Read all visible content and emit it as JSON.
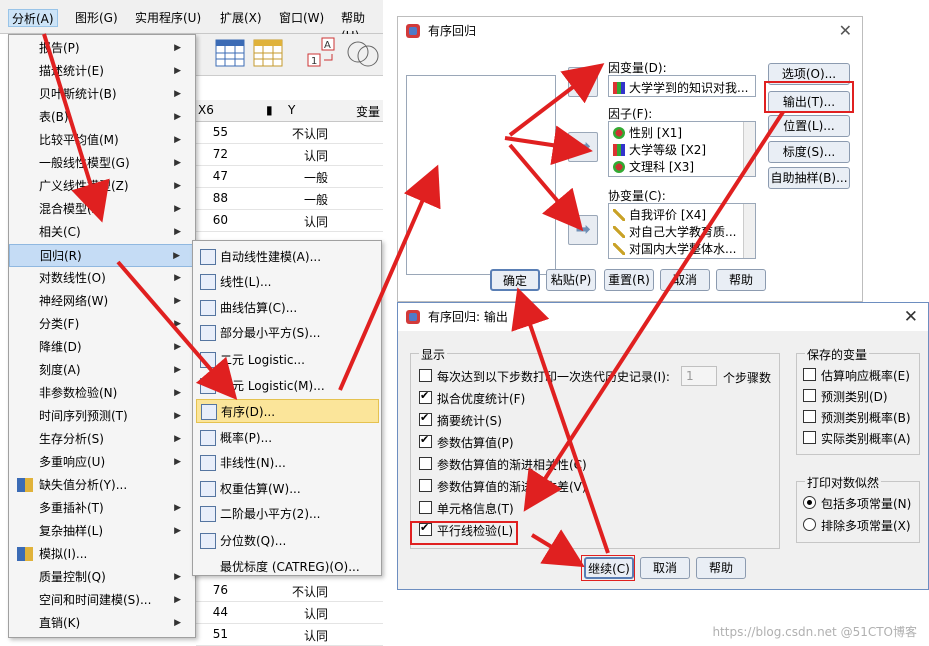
{
  "menubar": [
    "分析(A)",
    "图形(G)",
    "实用程序(U)",
    "扩展(X)",
    "窗口(W)",
    "帮助(H)"
  ],
  "analyze_menu": [
    {
      "label": "报告(P)",
      "arrow": true
    },
    {
      "label": "描述统计(E)",
      "arrow": true
    },
    {
      "label": "贝叶斯统计(B)",
      "arrow": true
    },
    {
      "label": "表(B)",
      "arrow": true
    },
    {
      "label": "比较平均值(M)",
      "arrow": true
    },
    {
      "label": "一般线性模型(G)",
      "arrow": true
    },
    {
      "label": "广义线性模型(Z)",
      "arrow": true
    },
    {
      "label": "混合模型(X)",
      "arrow": true
    },
    {
      "label": "相关(C)",
      "arrow": true
    },
    {
      "label": "回归(R)",
      "arrow": true
    },
    {
      "label": "对数线性(O)",
      "arrow": true
    },
    {
      "label": "神经网络(W)",
      "arrow": true
    },
    {
      "label": "分类(F)",
      "arrow": true
    },
    {
      "label": "降维(D)",
      "arrow": true
    },
    {
      "label": "刻度(A)",
      "arrow": true
    },
    {
      "label": "非参数检验(N)",
      "arrow": true
    },
    {
      "label": "时间序列预测(T)",
      "arrow": true
    },
    {
      "label": "生存分析(S)",
      "arrow": true
    },
    {
      "label": "多重响应(U)",
      "arrow": true
    },
    {
      "label": "缺失值分析(Y)...",
      "arrow": false
    },
    {
      "label": "多重插补(T)",
      "arrow": true
    },
    {
      "label": "复杂抽样(L)",
      "arrow": true
    },
    {
      "label": "模拟(I)...",
      "arrow": false
    },
    {
      "label": "质量控制(Q)",
      "arrow": true
    },
    {
      "label": "空间和时间建模(S)...",
      "arrow": true
    },
    {
      "label": "直销(K)",
      "arrow": true
    }
  ],
  "regression_menu": [
    "自动线性建模(A)...",
    "线性(L)...",
    "曲线估算(C)...",
    "部分最小平方(S)...",
    "二元 Logistic...",
    "多元 Logistic(M)...",
    "有序(D)...",
    "概率(P)...",
    "非线性(N)...",
    "权重估算(W)...",
    "二阶最小平方(2)...",
    "分位数(Q)...",
    "最优标度 (CATREG)(O)..."
  ],
  "grid": {
    "headers": [
      "X6",
      "Y",
      "变量"
    ],
    "rows": [
      [
        "55",
        "不认同"
      ],
      [
        "72",
        "认同"
      ],
      [
        "47",
        "一般"
      ],
      [
        "88",
        "一般"
      ],
      [
        "60",
        "认同"
      ],
      [
        "76",
        "不认同"
      ],
      [
        "44",
        "认同"
      ],
      [
        "51",
        "认同"
      ]
    ]
  },
  "dialog1": {
    "title": "有序回归",
    "dependent_label": "因变量(D):",
    "dependent_value": "大学学到的知识对我...",
    "factor_label": "因子(F):",
    "factors": [
      "性别 [X1]",
      "大学等级 [X2]",
      "文理科 [X3]"
    ],
    "covariate_label": "协变量(C):",
    "covariates": [
      "自我评价 [X4]",
      "对自己大学教育质...",
      "对国内大学整体水..."
    ],
    "side_buttons": [
      "选项(O)...",
      "输出(T)...",
      "位置(L)...",
      "标度(S)...",
      "自助抽样(B)..."
    ],
    "bottom_buttons": [
      "确定",
      "粘贴(P)",
      "重置(R)",
      "取消",
      "帮助"
    ]
  },
  "dialog2": {
    "title": "有序回归: 输出",
    "display_group": "显示",
    "display_options": [
      {
        "label": "每次达到以下步数打印一次迭代历史记录(I):",
        "checked": false
      },
      {
        "label": "拟合优度统计(F)",
        "checked": true
      },
      {
        "label": "摘要统计(S)",
        "checked": true
      },
      {
        "label": "参数估算值(P)",
        "checked": true
      },
      {
        "label": "参数估算值的渐进相关性(C)",
        "checked": false
      },
      {
        "label": "参数估算值的渐进协方差(V)",
        "checked": false
      },
      {
        "label": "单元格信息(T)",
        "checked": false
      },
      {
        "label": "平行线检验(L)",
        "checked": true
      }
    ],
    "step_value": "1",
    "step_suffix": "个步骤数",
    "saved_group": "保存的变量",
    "saved_options": [
      "估算响应概率(E)",
      "预测类别(D)",
      "预测类别概率(B)",
      "实际类别概率(A)"
    ],
    "loglik_group": "打印对数似然",
    "loglik_options": [
      {
        "label": "包括多项常量(N)",
        "selected": true
      },
      {
        "label": "排除多项常量(X)",
        "selected": false
      }
    ],
    "buttons": [
      "继续(C)",
      "取消",
      "帮助"
    ]
  },
  "watermark": "https://blog.csdn.net  @51CTO博客",
  "colors": {
    "highlight_yellow": "#fbe59a",
    "menu_select_blue": "#c5dcf5",
    "annotation_red": "#e02020"
  }
}
